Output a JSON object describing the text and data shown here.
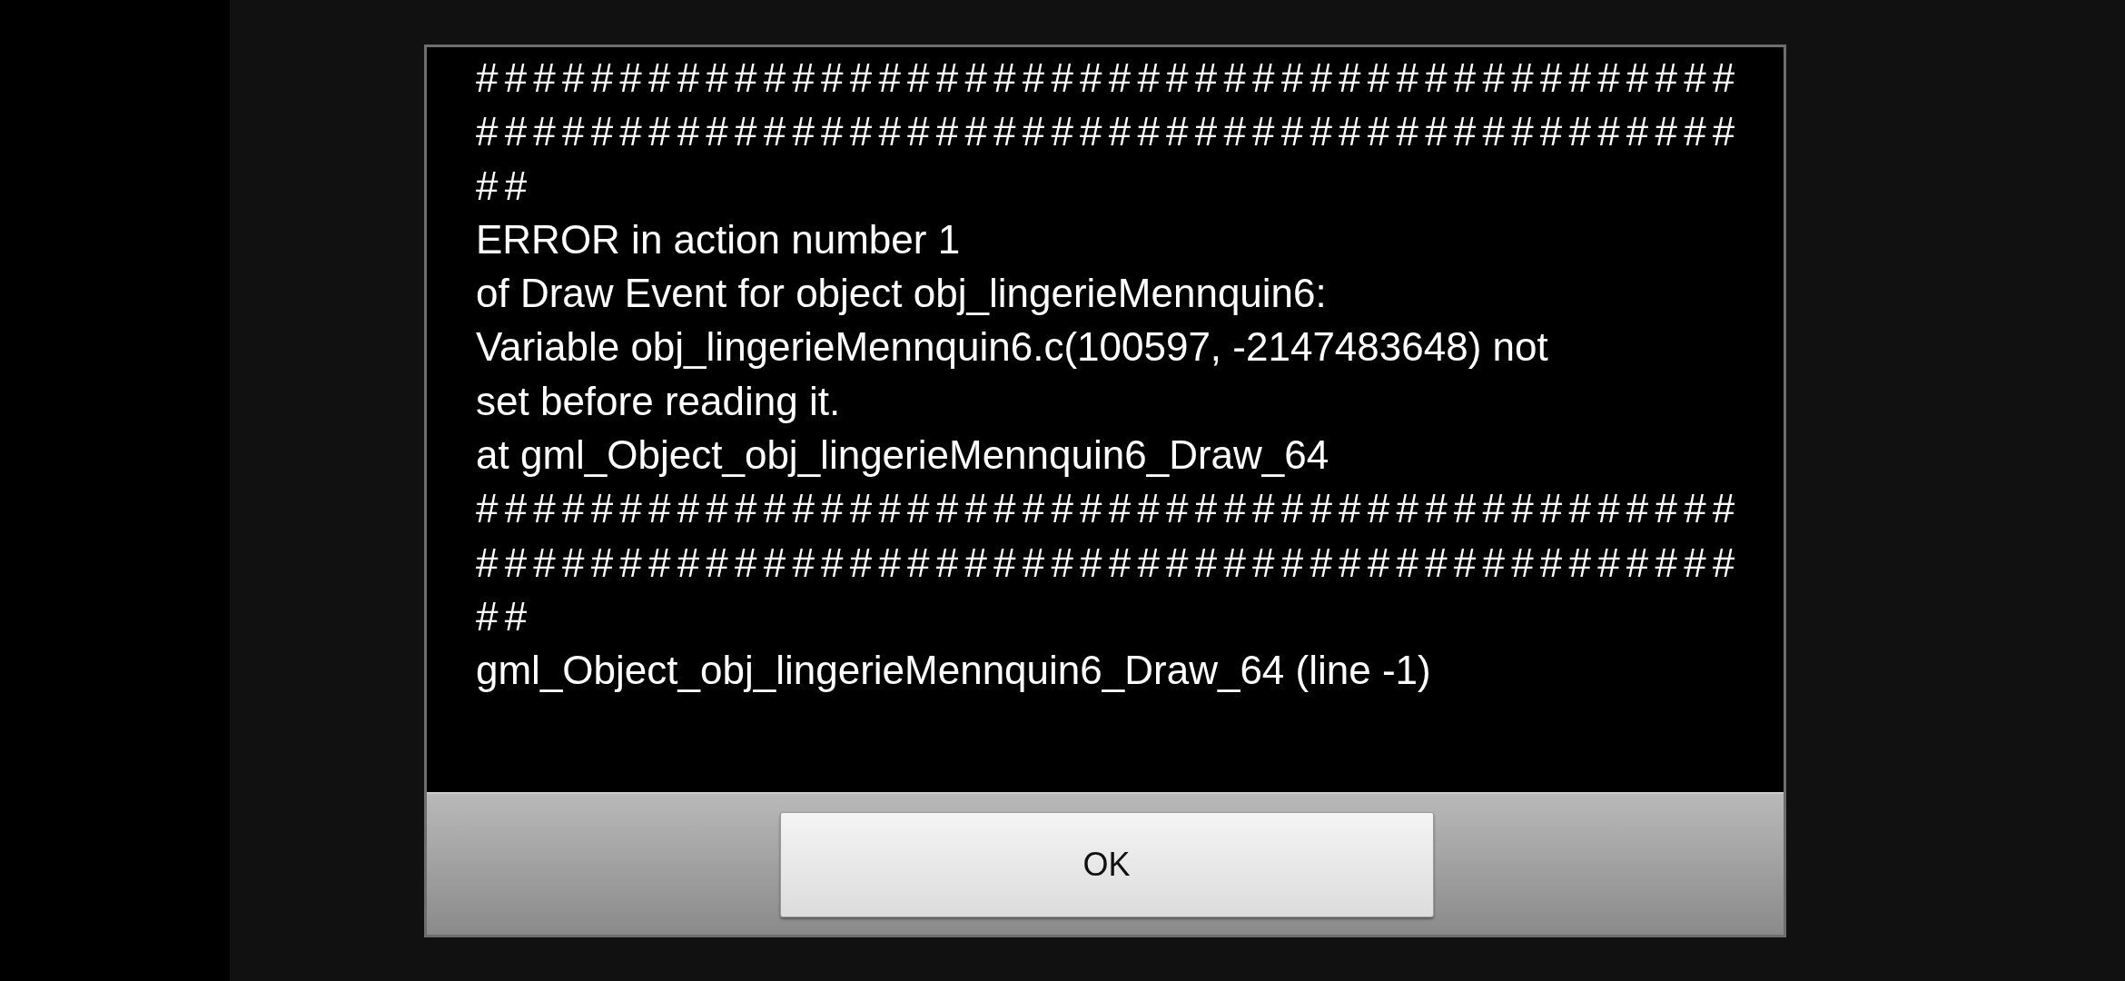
{
  "dialog": {
    "message_lines": [
      {
        "kind": "rule",
        "text": "############################################"
      },
      {
        "kind": "rule",
        "text": "############################################"
      },
      {
        "kind": "rule",
        "text": "##"
      },
      {
        "kind": "text",
        "text": "ERROR in action number 1"
      },
      {
        "kind": "text",
        "text": "of Draw Event for object obj_lingerieMennquin6:"
      },
      {
        "kind": "text",
        "text": "Variable obj_lingerieMennquin6.c(100597, -2147483648) not"
      },
      {
        "kind": "text",
        "text": "set before reading it."
      },
      {
        "kind": "text",
        "text": "at gml_Object_obj_lingerieMennquin6_Draw_64"
      },
      {
        "kind": "rule",
        "text": "############################################"
      },
      {
        "kind": "rule",
        "text": "############################################"
      },
      {
        "kind": "rule",
        "text": "##"
      },
      {
        "kind": "text",
        "text": "gml_Object_obj_lingerieMennquin6_Draw_64 (line -1)"
      }
    ],
    "button": "OK"
  }
}
